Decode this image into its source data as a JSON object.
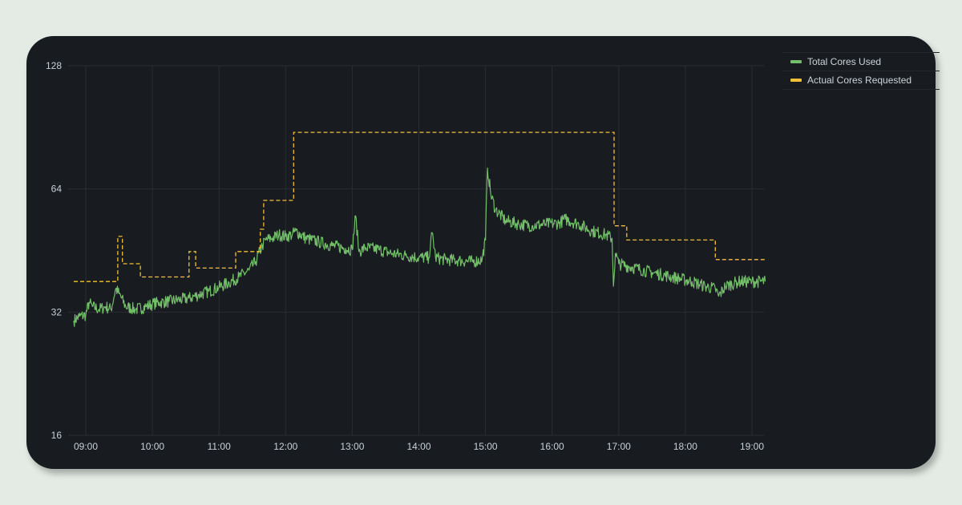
{
  "colors": {
    "used": "#73bf69",
    "requested": "#f2c037",
    "grid": "#2a2d33"
  },
  "legend": [
    {
      "label": "Total Cores Used",
      "color": "#73bf69"
    },
    {
      "label": "Actual Cores Requested",
      "color": "#f2c037"
    }
  ],
  "chart_data": {
    "type": "line",
    "yscale": "log2",
    "ylim": [
      16,
      128
    ],
    "yticks": [
      "16",
      "32",
      "64",
      "128"
    ],
    "xticks": [
      "09:00",
      "10:00",
      "11:00",
      "12:00",
      "13:00",
      "14:00",
      "15:00",
      "16:00",
      "17:00",
      "18:00",
      "19:00"
    ],
    "xlim_hours": [
      8.82,
      19.2
    ],
    "grid": true,
    "legend_position": "top-right",
    "series": [
      {
        "name": "Total Cores Used",
        "color": "#73bf69",
        "style": "solid",
        "x": [
          8.82,
          8.9,
          9.0,
          9.05,
          9.1,
          9.2,
          9.3,
          9.38,
          9.45,
          9.5,
          9.6,
          9.75,
          9.9,
          10.0,
          10.1,
          10.25,
          10.4,
          10.55,
          10.7,
          10.85,
          11.0,
          11.15,
          11.3,
          11.45,
          11.55,
          11.65,
          11.7,
          11.8,
          11.9,
          12.0,
          12.1,
          12.15,
          12.3,
          12.5,
          12.7,
          12.9,
          13.0,
          13.05,
          13.1,
          13.2,
          13.4,
          13.6,
          13.8,
          14.0,
          14.15,
          14.2,
          14.25,
          14.4,
          14.6,
          14.8,
          14.95,
          15.0,
          15.03,
          15.08,
          15.15,
          15.3,
          15.5,
          15.7,
          15.9,
          16.1,
          16.2,
          16.4,
          16.6,
          16.8,
          16.9,
          16.92,
          16.95,
          17.0,
          17.2,
          17.5,
          17.8,
          18.1,
          18.3,
          18.45,
          18.5,
          18.6,
          18.8,
          19.0,
          19.2
        ],
        "y": [
          30.5,
          31.2,
          31.5,
          33.8,
          33.0,
          32.5,
          33.0,
          32.5,
          36.5,
          35.5,
          33.0,
          32.5,
          33.0,
          33.5,
          33.8,
          34.0,
          34.3,
          34.6,
          35.3,
          36.0,
          36.8,
          37.8,
          39.0,
          40.5,
          42.5,
          46.5,
          48.0,
          48.5,
          49.5,
          49.0,
          49.5,
          50.5,
          48.5,
          47.5,
          46.5,
          45.8,
          45.5,
          55.0,
          45.0,
          46.0,
          45.5,
          44.5,
          44.0,
          43.5,
          43.5,
          50.0,
          43.5,
          43.0,
          42.8,
          42.5,
          43.0,
          48.0,
          72.0,
          62.0,
          57.0,
          53.5,
          52.5,
          52.0,
          52.5,
          52.8,
          54.0,
          52.5,
          50.5,
          49.5,
          48.5,
          37.0,
          44.5,
          42.0,
          41.2,
          40.0,
          39.0,
          38.0,
          37.0,
          36.5,
          35.0,
          37.0,
          38.0,
          38.0,
          38.0
        ]
      },
      {
        "name": "Actual Cores Requested",
        "color": "#f2c037",
        "style": "dashed",
        "x": [
          8.82,
          9.48,
          9.48,
          9.55,
          9.55,
          9.82,
          9.82,
          10.55,
          10.55,
          10.65,
          10.65,
          11.25,
          11.25,
          11.62,
          11.62,
          11.67,
          11.67,
          12.12,
          12.12,
          16.93,
          16.93,
          17.12,
          17.12,
          18.45,
          18.45,
          19.2
        ],
        "y": [
          38,
          38,
          49,
          49,
          42,
          42,
          39,
          39,
          45,
          45,
          41,
          41,
          45,
          45,
          51,
          51,
          60,
          60,
          88,
          88,
          52,
          52,
          48,
          48,
          43,
          43
        ]
      }
    ]
  }
}
